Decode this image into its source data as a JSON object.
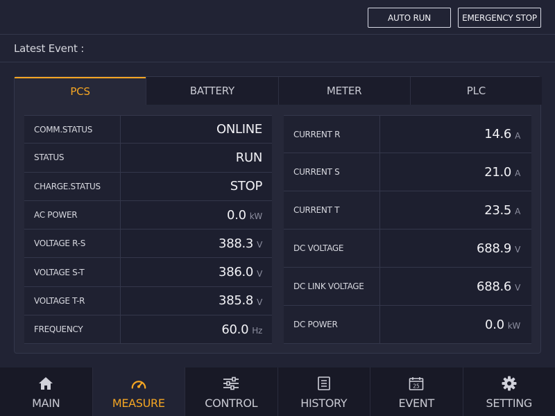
{
  "header": {
    "auto_run_label": "AUTO RUN",
    "emergency_stop_label": "EMERGENCY STOP"
  },
  "event_bar": {
    "label": "Latest Event :",
    "value": ""
  },
  "tabs": [
    {
      "label": "PCS",
      "active": true
    },
    {
      "label": "BATTERY",
      "active": false
    },
    {
      "label": "METER",
      "active": false
    },
    {
      "label": "PLC",
      "active": false
    }
  ],
  "pcs": {
    "left": [
      {
        "label": "COMM.STATUS",
        "value": "ONLINE",
        "unit": ""
      },
      {
        "label": "STATUS",
        "value": "RUN",
        "unit": ""
      },
      {
        "label": "CHARGE.STATUS",
        "value": "STOP",
        "unit": ""
      },
      {
        "label": "AC POWER",
        "value": "0.0",
        "unit": "kW"
      },
      {
        "label": "VOLTAGE R-S",
        "value": "388.3",
        "unit": "V"
      },
      {
        "label": "VOLTAGE S-T",
        "value": "386.0",
        "unit": "V"
      },
      {
        "label": "VOLTAGE T-R",
        "value": "385.8",
        "unit": "V"
      },
      {
        "label": "FREQUENCY",
        "value": "60.0",
        "unit": "Hz"
      }
    ],
    "right": [
      {
        "label": "CURRENT R",
        "value": "14.6",
        "unit": "A"
      },
      {
        "label": "CURRENT S",
        "value": "21.0",
        "unit": "A"
      },
      {
        "label": "CURRENT T",
        "value": "23.5",
        "unit": "A"
      },
      {
        "label": "DC VOLTAGE",
        "value": "688.9",
        "unit": "V"
      },
      {
        "label": "DC LINK VOLTAGE",
        "value": "688.6",
        "unit": "V"
      },
      {
        "label": "DC POWER",
        "value": "0.0",
        "unit": "kW"
      }
    ]
  },
  "nav": [
    {
      "label": "MAIN",
      "icon": "home-icon",
      "active": false
    },
    {
      "label": "MEASURE",
      "icon": "gauge-icon",
      "active": true
    },
    {
      "label": "CONTROL",
      "icon": "sliders-icon",
      "active": false
    },
    {
      "label": "HISTORY",
      "icon": "document-list-icon",
      "active": false
    },
    {
      "label": "EVENT",
      "icon": "calendar-icon",
      "active": false,
      "icon_text": "25"
    },
    {
      "label": "SETTING",
      "icon": "gear-icon",
      "active": false
    }
  ],
  "colors": {
    "background": "#212334",
    "accent": "#f5a623",
    "panel": "#262839",
    "cell": "#1d1f2f"
  }
}
